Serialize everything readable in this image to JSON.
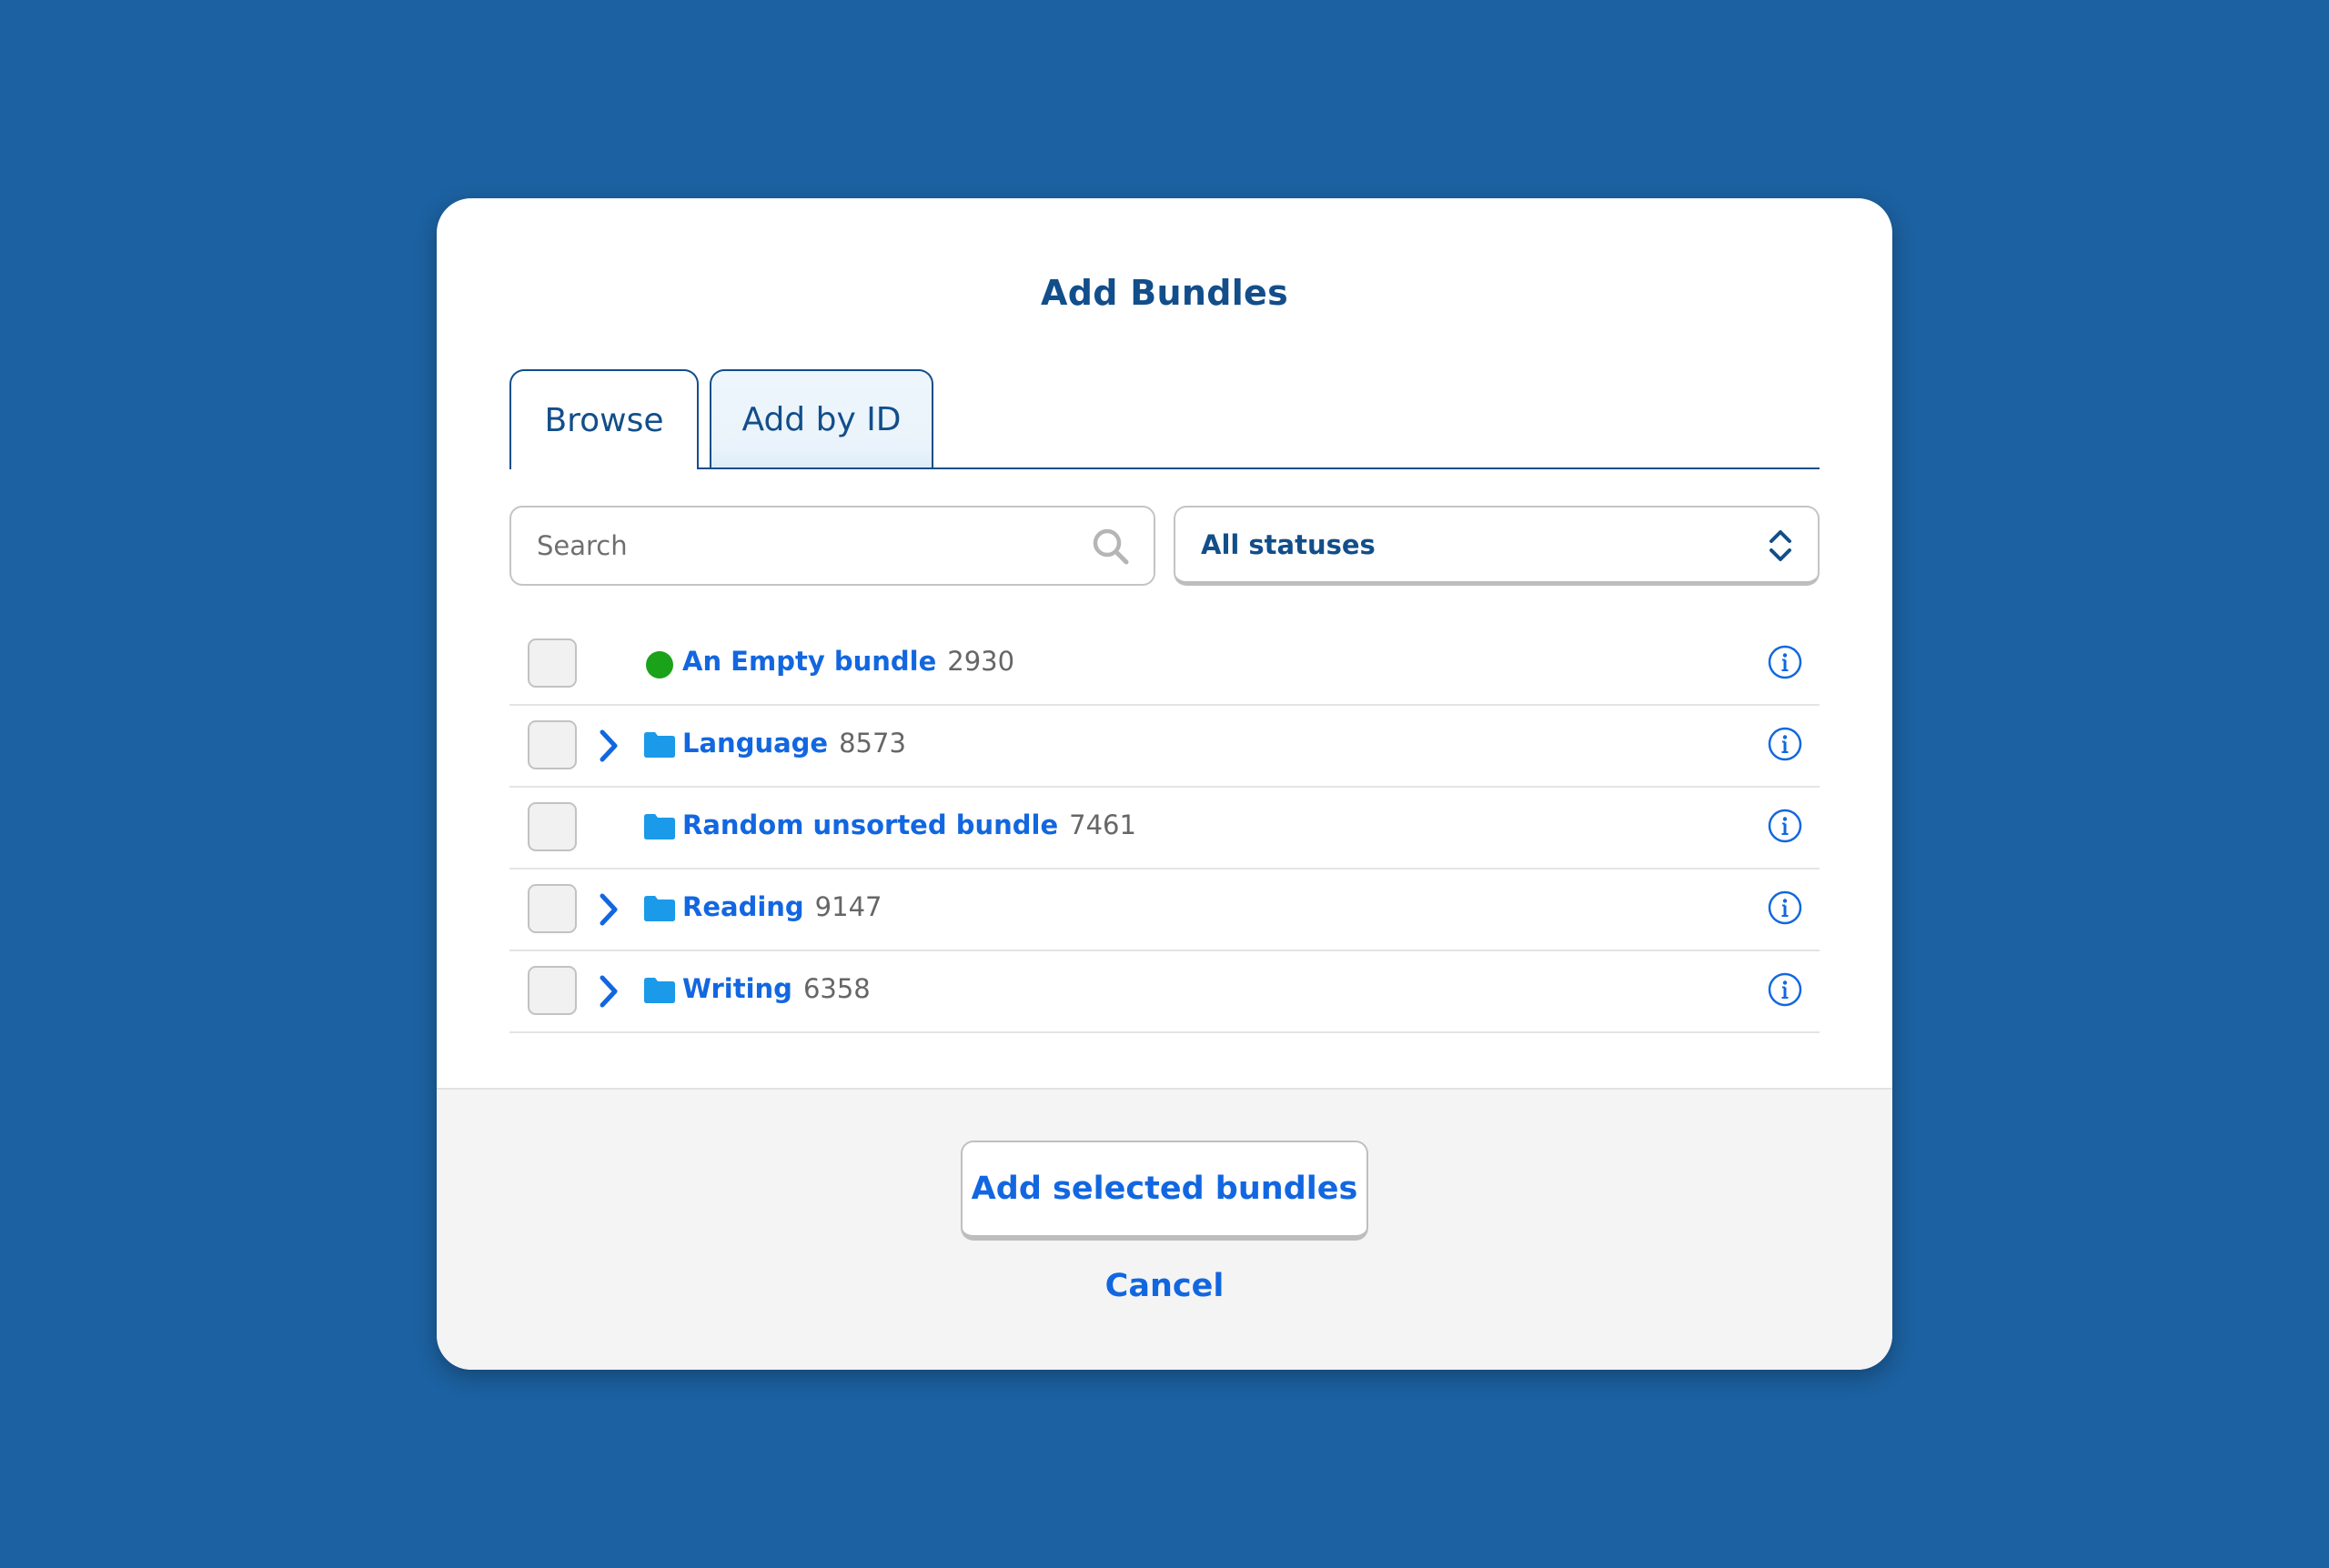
{
  "modal": {
    "title": "Add Bundles"
  },
  "tabs": [
    {
      "label": "Browse",
      "active": true
    },
    {
      "label": "Add by ID",
      "active": false
    }
  ],
  "search": {
    "placeholder": "Search",
    "value": ""
  },
  "status_filter": {
    "selected": "All statuses"
  },
  "bundles": [
    {
      "name": "An Empty bundle",
      "id": "2930",
      "type": "bundle",
      "expandable": false,
      "checked": false,
      "status_color": "#1aa21a"
    },
    {
      "name": "Language",
      "id": "8573",
      "type": "folder",
      "expandable": true,
      "checked": false
    },
    {
      "name": "Random unsorted bundle",
      "id": "7461",
      "type": "folder",
      "expandable": false,
      "checked": false
    },
    {
      "name": "Reading",
      "id": "9147",
      "type": "folder",
      "expandable": true,
      "checked": false
    },
    {
      "name": "Writing",
      "id": "6358",
      "type": "folder",
      "expandable": true,
      "checked": false
    }
  ],
  "footer": {
    "primary_label": "Add selected bundles",
    "cancel_label": "Cancel"
  },
  "colors": {
    "background": "#1c61a1",
    "heading": "#124e8a",
    "link": "#1267e0",
    "folder": "#1a9ae8",
    "status_active": "#1aa21a"
  },
  "icons": {
    "search": "search-icon",
    "select": "chevron-up-down-icon",
    "expand": "chevron-right-icon",
    "folder": "folder-icon",
    "info": "info-icon"
  }
}
